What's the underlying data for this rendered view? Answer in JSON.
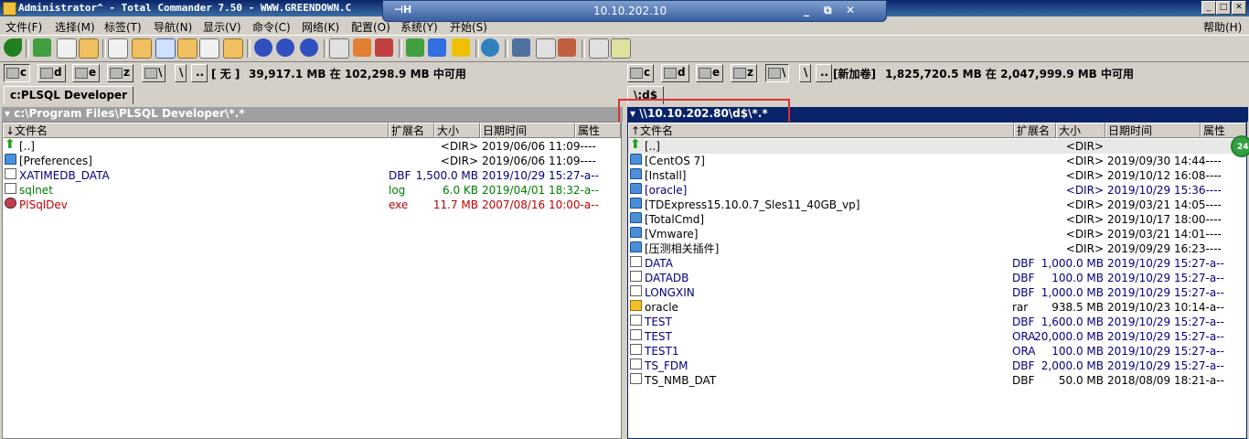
{
  "window": {
    "title": "Administrator^ - Total Commander 7.50 - WWW.GREENDOWN.C",
    "rdp_host": "10.10.202.10",
    "rdp_buttons": [
      "_",
      "⧉",
      "✕"
    ],
    "win_buttons": [
      "_",
      "□",
      "✕"
    ]
  },
  "menu": {
    "left": [
      "文件(F)",
      "选择(M)",
      "标签(T)",
      "导航(N)",
      "显示(V)",
      "命令(C)",
      "网络(K)",
      "配置(O)",
      "系统(Y)",
      "开始(S)"
    ],
    "right": "帮助(H)"
  },
  "left": {
    "drives": [
      "c",
      "d",
      "e",
      "z",
      "\\",
      "..",
      "[ 无 ]"
    ],
    "drive_info": "39,917.1 MB 在 102,298.9 MB 中可用",
    "tab": "c:PLSQL Developer",
    "path": "▾ c:\\Program Files\\PLSQL Developer\\*.*",
    "headers": {
      "name": "↓文件名",
      "ext": "扩展名",
      "size": "大小",
      "date": "日期时间",
      "attr": "属性"
    },
    "rows": [
      {
        "icon": "up",
        "name": "[..]",
        "ext": "",
        "size": "<DIR>",
        "date": "2019/06/06 11:09----",
        "color": "#000000"
      },
      {
        "icon": "folder",
        "name": "[Preferences]",
        "ext": "",
        "size": "<DIR>",
        "date": "2019/06/06 11:09----",
        "color": "#000000"
      },
      {
        "icon": "file",
        "name": "XATIMEDB_DATA",
        "ext": "DBF",
        "size": "1,500.0 MB",
        "date": "2019/10/29 15:27-a--",
        "color": "#000080"
      },
      {
        "icon": "file",
        "name": "sqlnet",
        "ext": "log",
        "size": "6.0 KB",
        "date": "2019/04/01 18:32-a--",
        "color": "#008000"
      },
      {
        "icon": "exe",
        "name": "PlSqlDev",
        "ext": "exe",
        "size": "11.7 MB",
        "date": "2007/08/16 10:00-a--",
        "color": "#c00000"
      }
    ]
  },
  "right": {
    "drives": [
      "c",
      "d",
      "e",
      "z",
      "\\",
      "..",
      "[新加卷]"
    ],
    "drive_info": "1,825,720.5 MB 在 2,047,999.9 MB 中可用",
    "tab": "\\:d$",
    "path": "▾ \\\\10.10.202.80\\d$\\*.*",
    "headers": {
      "name": "↑文件名",
      "ext": "扩展名",
      "size": "大小",
      "date": "日期时间",
      "attr": "属性"
    },
    "rows": [
      {
        "icon": "up",
        "name": "[..]",
        "ext": "",
        "size": "<DIR>",
        "date": "",
        "color": "#000000"
      },
      {
        "icon": "folder",
        "name": "[CentOS 7]",
        "ext": "",
        "size": "<DIR>",
        "date": "2019/09/30 14:44----",
        "color": "#000000"
      },
      {
        "icon": "folder",
        "name": "[Install]",
        "ext": "",
        "size": "<DIR>",
        "date": "2019/10/12 16:08----",
        "color": "#000000"
      },
      {
        "icon": "folder",
        "name": "[oracle]",
        "ext": "",
        "size": "<DIR>",
        "date": "2019/10/29 15:36----",
        "color": "#000080"
      },
      {
        "icon": "folder",
        "name": "[TDExpress15.10.0.7_Sles11_40GB_vp]",
        "ext": "",
        "size": "<DIR>",
        "date": "2019/03/21 14:05----",
        "color": "#000000"
      },
      {
        "icon": "folder",
        "name": "[TotalCmd]",
        "ext": "",
        "size": "<DIR>",
        "date": "2019/10/17 18:00----",
        "color": "#000000"
      },
      {
        "icon": "folder",
        "name": "[Vmware]",
        "ext": "",
        "size": "<DIR>",
        "date": "2019/03/21 14:01----",
        "color": "#000000"
      },
      {
        "icon": "folder",
        "name": "[压测相关插件]",
        "ext": "",
        "size": "<DIR>",
        "date": "2019/09/29 16:23----",
        "color": "#000000"
      },
      {
        "icon": "file",
        "name": "DATA",
        "ext": "DBF",
        "size": "1,000.0 MB",
        "date": "2019/10/29 15:27-a--",
        "color": "#000080"
      },
      {
        "icon": "file",
        "name": "DATADB",
        "ext": "DBF",
        "size": "100.0 MB",
        "date": "2019/10/29 15:27-a--",
        "color": "#000080"
      },
      {
        "icon": "file",
        "name": "LONGXIN",
        "ext": "DBF",
        "size": "1,000.0 MB",
        "date": "2019/10/29 15:27-a--",
        "color": "#000080"
      },
      {
        "icon": "rar",
        "name": "oracle",
        "ext": "rar",
        "size": "938.5 MB",
        "date": "2019/10/23 10:14-a--",
        "color": "#000000"
      },
      {
        "icon": "file",
        "name": "TEST",
        "ext": "DBF",
        "size": "1,600.0 MB",
        "date": "2019/10/29 15:27-a--",
        "color": "#000080"
      },
      {
        "icon": "file",
        "name": "TEST",
        "ext": "ORA",
        "size": "20,000.0 MB",
        "date": "2019/10/29 15:27-a--",
        "color": "#000080"
      },
      {
        "icon": "file",
        "name": "TEST1",
        "ext": "ORA",
        "size": "100.0 MB",
        "date": "2019/10/29 15:27-a--",
        "color": "#000080"
      },
      {
        "icon": "file",
        "name": "TS_FDM",
        "ext": "DBF",
        "size": "2,000.0 MB",
        "date": "2019/10/29 15:27-a--",
        "color": "#000080"
      },
      {
        "icon": "file",
        "name": "TS_NMB_DAT",
        "ext": "DBF",
        "size": "50.0 MB",
        "date": "2018/08/09 18:21-a--",
        "color": "#000000"
      }
    ]
  },
  "overlay_badge": "24"
}
